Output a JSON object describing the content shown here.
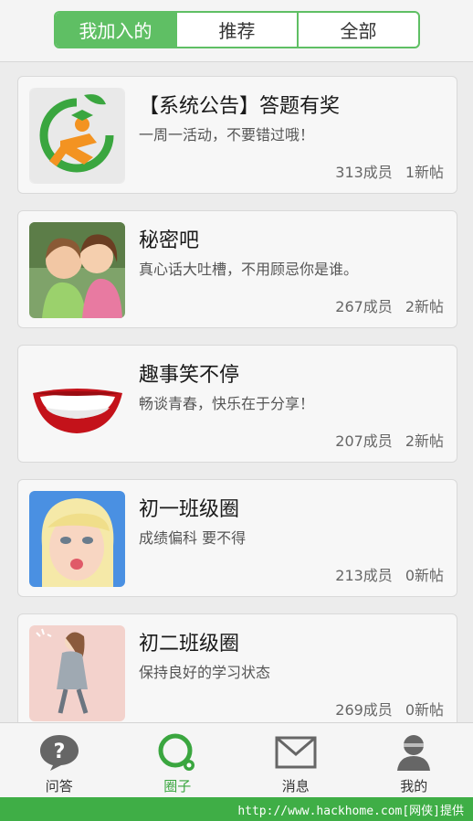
{
  "tabs": [
    {
      "label": "我加入的",
      "active": true
    },
    {
      "label": "推荐",
      "active": false
    },
    {
      "label": "全部",
      "active": false
    }
  ],
  "groups": [
    {
      "title": "【系统公告】答题有奖",
      "desc": "一周一活动，不要错过哦！",
      "members": "313成员",
      "posts": "1新帖",
      "icon": "education-logo-icon"
    },
    {
      "title": "秘密吧",
      "desc": "真心话大吐槽，不用顾忌你是谁。",
      "members": "267成员",
      "posts": "2新帖",
      "icon": "children-whisper-photo"
    },
    {
      "title": "趣事笑不停",
      "desc": "畅谈青春，快乐在于分享！",
      "members": "207成员",
      "posts": "2新帖",
      "icon": "smiling-lips-icon"
    },
    {
      "title": "初一班级圈",
      "desc": "成绩偏科 要不得",
      "members": "213成员",
      "posts": "0新帖",
      "icon": "cartoon-girl-avatar"
    },
    {
      "title": "初二班级圈",
      "desc": "保持良好的学习状态",
      "members": "269成员",
      "posts": "0新帖",
      "icon": "walking-girl-illustration"
    }
  ],
  "nav": [
    {
      "label": "问答",
      "icon": "question-bubble-icon",
      "active": false
    },
    {
      "label": "圈子",
      "icon": "circle-search-icon",
      "active": true
    },
    {
      "label": "消息",
      "icon": "envelope-icon",
      "active": false
    },
    {
      "label": "我的",
      "icon": "person-icon",
      "active": false
    }
  ],
  "watermark": "http://www.hackhome.com[网侠]提供",
  "colors": {
    "accent": "#5fbf64",
    "watermark_bg": "#3fae46"
  }
}
